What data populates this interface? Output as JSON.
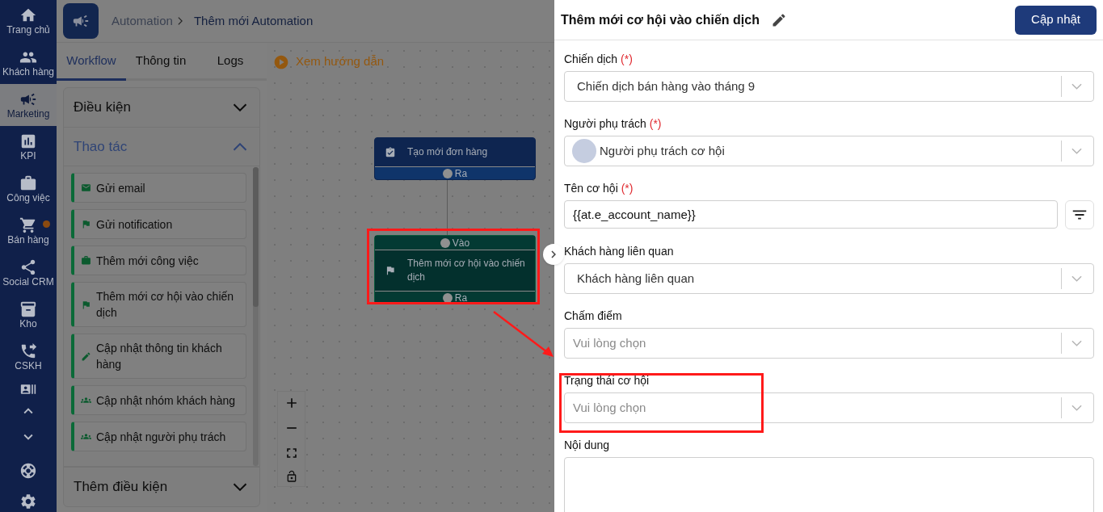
{
  "sidebar": {
    "items": [
      {
        "label": "Trang chủ",
        "selected": false,
        "badge": false
      },
      {
        "label": "Khách hàng",
        "selected": false,
        "badge": false
      },
      {
        "label": "Marketing",
        "selected": true,
        "badge": false
      },
      {
        "label": "KPI",
        "selected": false,
        "badge": false
      },
      {
        "label": "Công việc",
        "selected": false,
        "badge": false
      },
      {
        "label": "Bán hàng",
        "selected": false,
        "badge": true
      },
      {
        "label": "Social CRM",
        "selected": false,
        "badge": false
      },
      {
        "label": "Kho",
        "selected": false,
        "badge": false
      },
      {
        "label": "CSKH",
        "selected": false,
        "badge": false
      }
    ]
  },
  "breadcrumb": [
    "Automation",
    "Thêm mới Automation"
  ],
  "tabs": [
    {
      "label": "Workflow",
      "selected": true
    },
    {
      "label": "Thông tin",
      "selected": false
    },
    {
      "label": "Logs",
      "selected": false
    }
  ],
  "guide_link": "Xem hướng dẫn",
  "palette": {
    "sections": [
      {
        "title": "Điều kiện",
        "expanded": false
      },
      {
        "title": "Thao tác",
        "expanded": true,
        "items": [
          "Gửi email",
          "Gửi notification",
          "Thêm mới công việc",
          "Thêm mới cơ hội vào chiến dịch",
          "Cập nhật thông tin khách hàng",
          "Cập nhật nhóm khách hàng",
          "Cập nhật người phụ trách"
        ]
      },
      {
        "title": "Thêm điều kiện",
        "expanded": false
      }
    ]
  },
  "canvas": {
    "nodes": [
      {
        "kind": "trigger",
        "title": "Tạo mới đơn hàng",
        "output": "Ra"
      },
      {
        "kind": "action",
        "title": "Thêm mới cơ hội vào chiến dịch",
        "input": "Vào",
        "output": "Ra"
      }
    ]
  },
  "drawer": {
    "title": "Thêm mới cơ hội vào chiến dịch",
    "submit": "Cập nhật",
    "fields": [
      {
        "kind": "select",
        "label": "Chiến dịch",
        "required_mark": "(*)",
        "value": "Chiến dịch bán hàng vào tháng 9"
      },
      {
        "kind": "user-select",
        "label": "Người phụ trách",
        "required_mark": "(*)",
        "value": "Người phụ trách cơ hội"
      },
      {
        "kind": "text",
        "label": "Tên cơ hội",
        "required_mark": "(*)",
        "value": "{{at.e_account_name}}"
      },
      {
        "kind": "select",
        "label": "Khách hàng liên quan",
        "value": "Khách hàng liên quan"
      },
      {
        "kind": "select",
        "label": "Chấm điểm",
        "placeholder": "Vui lòng chọn"
      },
      {
        "kind": "select",
        "label": "Trạng thái cơ hội",
        "placeholder": "Vui lòng chọn"
      },
      {
        "kind": "textarea",
        "label": "Nội dung"
      }
    ]
  }
}
